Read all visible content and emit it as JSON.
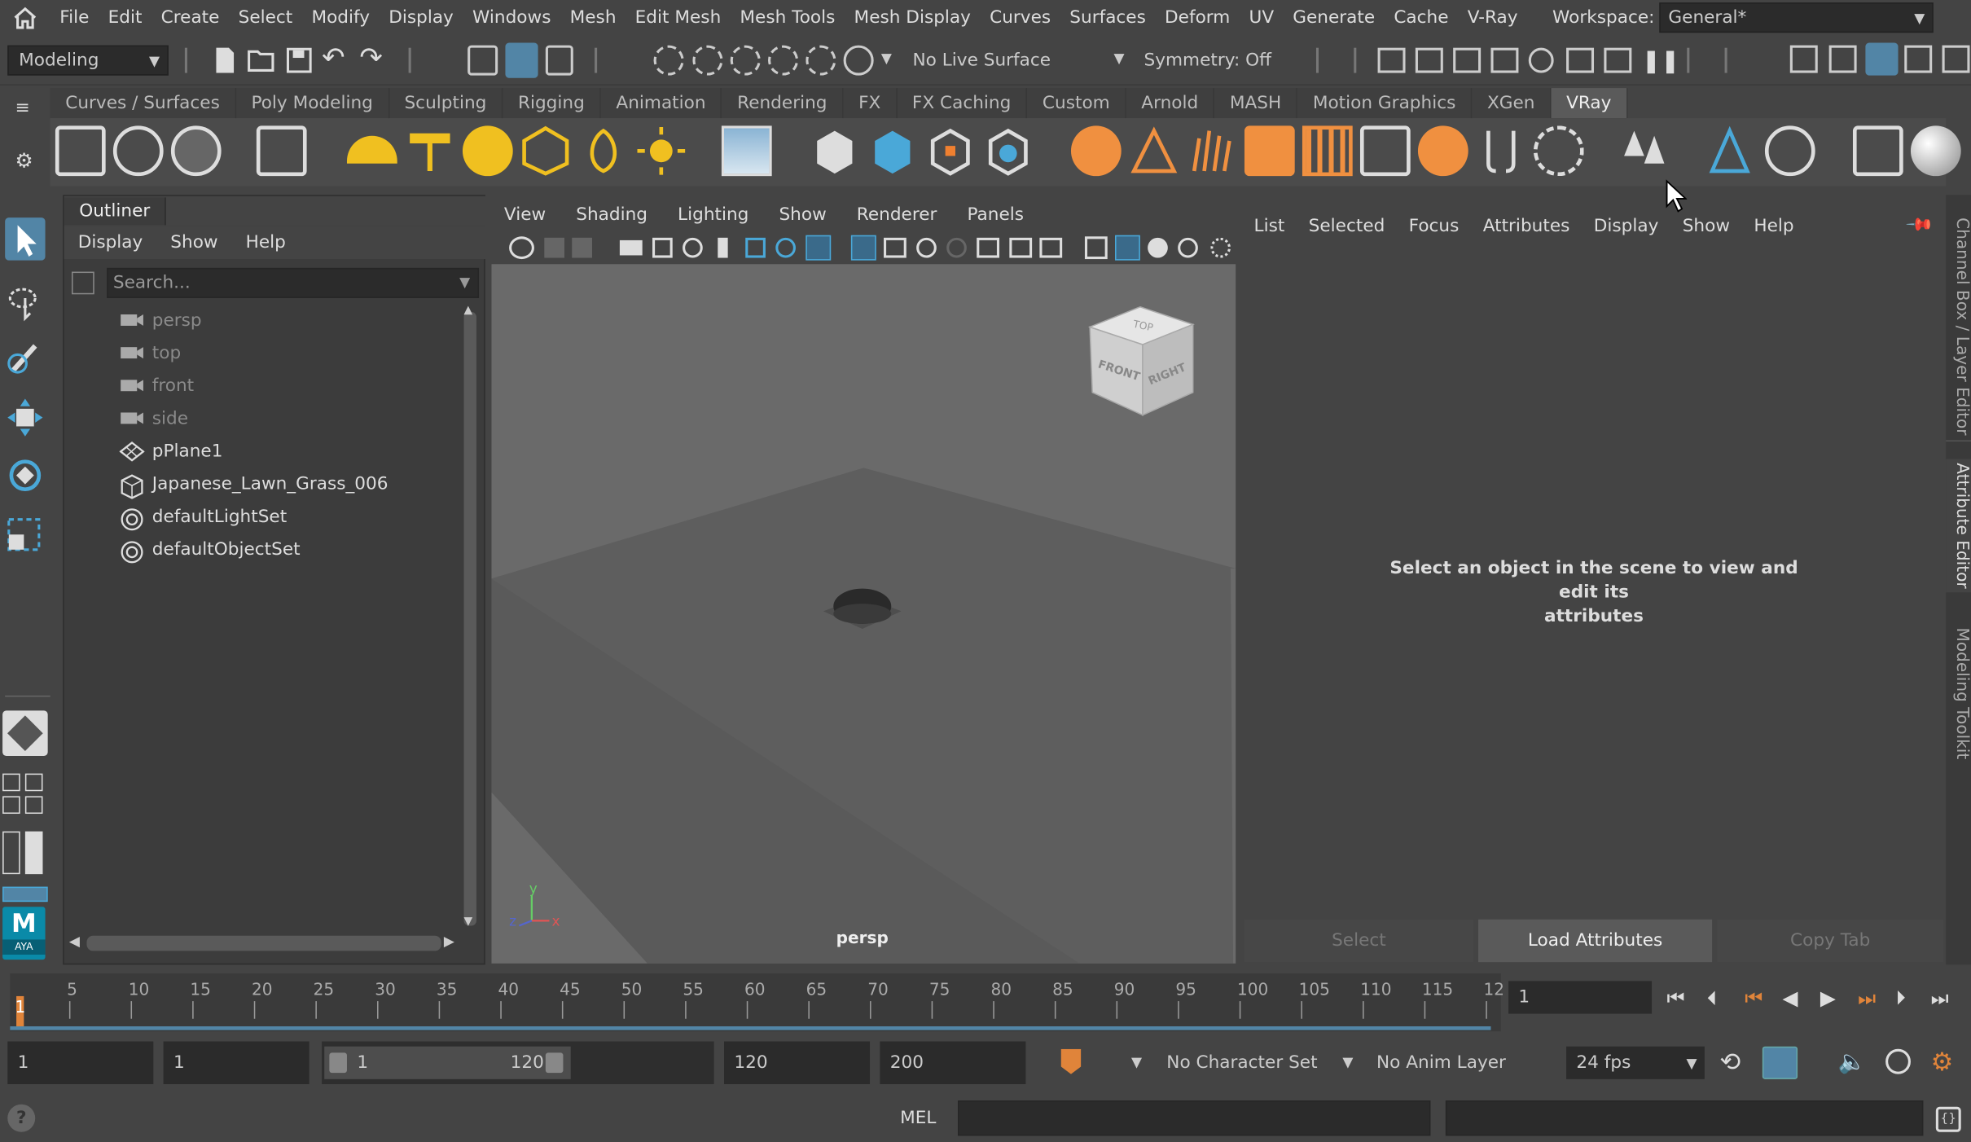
{
  "menubar": {
    "items": [
      "File",
      "Edit",
      "Create",
      "Select",
      "Modify",
      "Display",
      "Windows",
      "Mesh",
      "Edit Mesh",
      "Mesh Tools",
      "Mesh Display",
      "Curves",
      "Surfaces",
      "Deform",
      "UV",
      "Generate",
      "Cache",
      "V-Ray"
    ],
    "workspace_label": "Workspace:",
    "workspace_value": "General*"
  },
  "statusline": {
    "mode": "Modeling",
    "live_surface": "No Live Surface",
    "symmetry": "Symmetry: Off"
  },
  "shelf": {
    "tabs": [
      "Curves / Surfaces",
      "Poly Modeling",
      "Sculpting",
      "Rigging",
      "Animation",
      "Rendering",
      "FX",
      "FX Caching",
      "Custom",
      "Arnold",
      "MASH",
      "Motion Graphics",
      "XGen",
      "VRay"
    ],
    "active_tab": "VRay"
  },
  "outliner": {
    "title": "Outliner",
    "menu": [
      "Display",
      "Show",
      "Help"
    ],
    "search_placeholder": "Search...",
    "items": [
      {
        "label": "persp",
        "icon": "camera-icon",
        "dim": true
      },
      {
        "label": "top",
        "icon": "camera-icon",
        "dim": true
      },
      {
        "label": "front",
        "icon": "camera-icon",
        "dim": true
      },
      {
        "label": "side",
        "icon": "camera-icon",
        "dim": true
      },
      {
        "label": "pPlane1",
        "icon": "mesh-icon",
        "dim": false
      },
      {
        "label": "Japanese_Lawn_Grass_006",
        "icon": "cube-icon",
        "dim": false
      },
      {
        "label": "defaultLightSet",
        "icon": "set-icon",
        "dim": false
      },
      {
        "label": "defaultObjectSet",
        "icon": "set-icon",
        "dim": false
      }
    ]
  },
  "viewport": {
    "menu": [
      "View",
      "Shading",
      "Lighting",
      "Show",
      "Renderer",
      "Panels"
    ],
    "camera_label": "persp",
    "viewcube": {
      "top": "TOP",
      "front": "FRONT",
      "right": "RIGHT"
    },
    "axis": {
      "y": "y",
      "z": "z",
      "x": "x"
    }
  },
  "attribute_editor": {
    "menu": [
      "List",
      "Selected",
      "Focus",
      "Attributes",
      "Display",
      "Show",
      "Help"
    ],
    "message_line1": "Select an object in the scene to view and edit its",
    "message_line2": "attributes",
    "buttons": {
      "select": "Select",
      "load": "Load Attributes",
      "copy": "Copy Tab"
    }
  },
  "side_tabs": [
    "Channel Box / Layer Editor",
    "Attribute Editor",
    "Modeling Toolkit"
  ],
  "timeline": {
    "labels": [
      "5",
      "10",
      "15",
      "20",
      "25",
      "30",
      "35",
      "40",
      "45",
      "50",
      "55",
      "60",
      "65",
      "70",
      "75",
      "80",
      "85",
      "90",
      "95",
      "100",
      "105",
      "110",
      "115",
      "12"
    ],
    "current_frame_marker": "1",
    "current_frame_field": "1"
  },
  "range": {
    "start": "1",
    "playback_start": "1",
    "slider_start": "1",
    "slider_end": "120",
    "playback_end": "120",
    "end": "200",
    "character_set": "No Character Set",
    "anim_layer": "No Anim Layer",
    "fps": "24 fps"
  },
  "command_line": {
    "lang": "MEL",
    "help": "?"
  },
  "toolbox": {
    "logo_text": "M",
    "logo_sub": "AYA"
  },
  "colors": {
    "accent": "#5285a6",
    "shelf_bg": "#4b4b4b",
    "viewport_bg": "#6a6a6a",
    "panel_bg": "#444444",
    "playhead": "#e0843a"
  }
}
